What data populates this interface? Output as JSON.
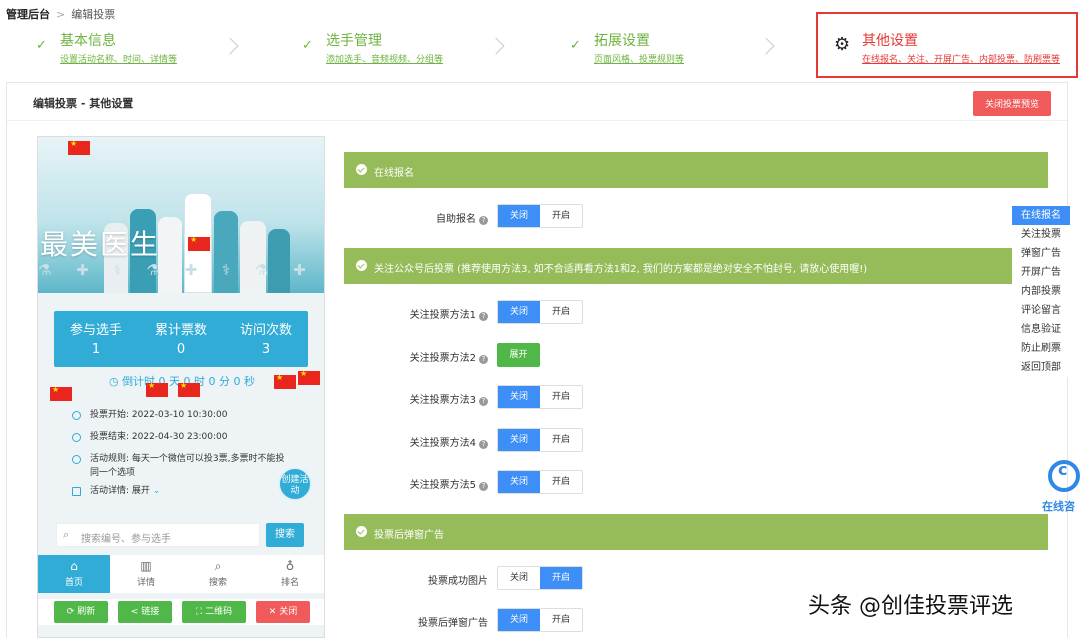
{
  "breadcrumb": {
    "root": "管理后台",
    "separator": ">",
    "current": "编辑投票"
  },
  "steps": [
    {
      "title": "基本信息",
      "sub": "设置活动名称、时间、详情等"
    },
    {
      "title": "选手管理",
      "sub": "添加选手、音频视频、分组等"
    },
    {
      "title": "拓展设置",
      "sub": "页面风格、投票规则等"
    }
  ],
  "active_step": {
    "title": "其他设置",
    "sub": "在线报名、关注、开屏广告、内部投票、防刷票等"
  },
  "panel": {
    "title": "编辑投票 - 其他设置",
    "close_preview_label": "关闭投票预览"
  },
  "phone": {
    "banner_title": "最美医生",
    "stats": [
      {
        "label": "参与选手",
        "value": "1"
      },
      {
        "label": "累计票数",
        "value": "0"
      },
      {
        "label": "访问次数",
        "value": "3"
      }
    ],
    "countdown": "倒计时 0 天 0 时 0 分 0 秒",
    "vote_start": "投票开始: 2022-03-10 10:30:00",
    "vote_end": "投票结束: 2022-04-30 23:00:00",
    "rules": "活动规则: 每天一个微信可以投3票,多票时不能投同一个选项",
    "details": "活动详情: 展开",
    "create_fab": "创建活动",
    "search_placeholder": "搜索编号、参与选手",
    "search_button": "搜索",
    "tabs": [
      {
        "icon": "⌂",
        "label": "首页"
      },
      {
        "icon": "▥",
        "label": "详情"
      },
      {
        "icon": "⌕",
        "label": "搜索"
      },
      {
        "icon": "♁",
        "label": "排名"
      }
    ],
    "actions": [
      {
        "label": "⟳ 刷新",
        "color": "#50b848"
      },
      {
        "label": "< 链接",
        "color": "#50b848"
      },
      {
        "label": "⛶ 二维码",
        "color": "#50b848"
      },
      {
        "label": "✕ 关闭",
        "color": "#f05a5a"
      }
    ]
  },
  "sections": {
    "online_signup": "在线报名",
    "follow_vote": "关注公众号后投票 (推荐使用方法3, 如不合适再看方法1和2, 我们的方案都是绝对安全不怕封号, 请放心使用喔!)",
    "popup_ads": "投票后弹窗广告"
  },
  "toggle_labels": {
    "off": "关闭",
    "on": "开启",
    "expand": "展开"
  },
  "rows": {
    "self_signup": {
      "label": "自助报名",
      "state": "off"
    },
    "method1": {
      "label": "关注投票方法1",
      "state": "off"
    },
    "method2": {
      "label": "关注投票方法2"
    },
    "method3": {
      "label": "关注投票方法3",
      "state": "off"
    },
    "method4": {
      "label": "关注投票方法4",
      "state": "off"
    },
    "method5": {
      "label": "关注投票方法5",
      "state": "off"
    },
    "success_image": {
      "label": "投票成功图片",
      "state": "on"
    },
    "popup_ad": {
      "label": "投票后弹窗广告",
      "state": "off"
    }
  },
  "sidenav": [
    "在线报名",
    "关注投票",
    "弹窗广告",
    "开屏广告",
    "内部投票",
    "评论留言",
    "信息验证",
    "防止刷票",
    "返回顶部"
  ],
  "consult": "在线咨",
  "watermark": "头条 @创佳投票评选"
}
